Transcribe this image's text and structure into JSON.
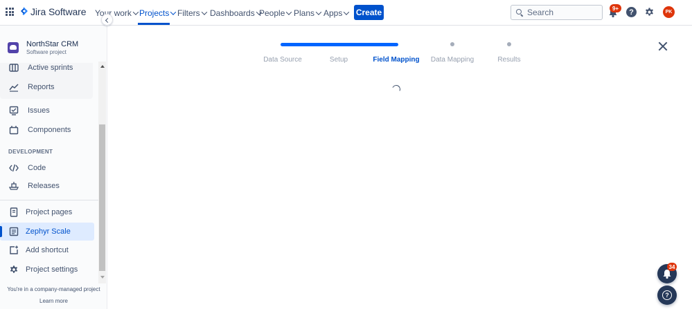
{
  "topnav": {
    "product_name": "Jira Software",
    "items": [
      {
        "label": "Your work",
        "active": false
      },
      {
        "label": "Projects",
        "active": true
      },
      {
        "label": "Filters",
        "active": false
      },
      {
        "label": "Dashboards",
        "active": false
      },
      {
        "label": "People",
        "active": false
      },
      {
        "label": "Plans",
        "active": false
      },
      {
        "label": "Apps",
        "active": false
      }
    ],
    "create_label": "Create",
    "search_placeholder": "Search",
    "notification_count": "9+",
    "help_symbol": "?",
    "avatar_initials": "PK",
    "accent_color": "#0052CC"
  },
  "sidebar": {
    "project_name": "NorthStar CRM",
    "project_type": "Software project",
    "planning_items": [
      {
        "label": "Active sprints",
        "icon": "board-icon"
      },
      {
        "label": "Reports",
        "icon": "reports-icon"
      }
    ],
    "items": [
      {
        "label": "Issues",
        "icon": "issues-icon"
      },
      {
        "label": "Components",
        "icon": "components-icon"
      }
    ],
    "development_heading": "DEVELOPMENT",
    "development_items": [
      {
        "label": "Code",
        "icon": "code-icon"
      },
      {
        "label": "Releases",
        "icon": "releases-icon"
      }
    ],
    "bottom_items": [
      {
        "label": "Project pages",
        "icon": "pages-icon",
        "selected": false
      },
      {
        "label": "Zephyr Scale",
        "icon": "zephyr-icon",
        "selected": true
      },
      {
        "label": "Add shortcut",
        "icon": "add-shortcut-icon",
        "selected": false
      },
      {
        "label": "Project settings",
        "icon": "gear-icon",
        "selected": false
      }
    ],
    "footer_text": "You're in a company-managed project",
    "footer_link": "Learn more"
  },
  "wizard": {
    "steps": [
      {
        "label": "Data Source",
        "state": "done"
      },
      {
        "label": "Setup",
        "state": "done"
      },
      {
        "label": "Field Mapping",
        "state": "current"
      },
      {
        "label": "Data Mapping",
        "state": "pending"
      },
      {
        "label": "Results",
        "state": "pending"
      }
    ]
  },
  "floating": {
    "notification_count": "34",
    "help_symbol": "?"
  }
}
